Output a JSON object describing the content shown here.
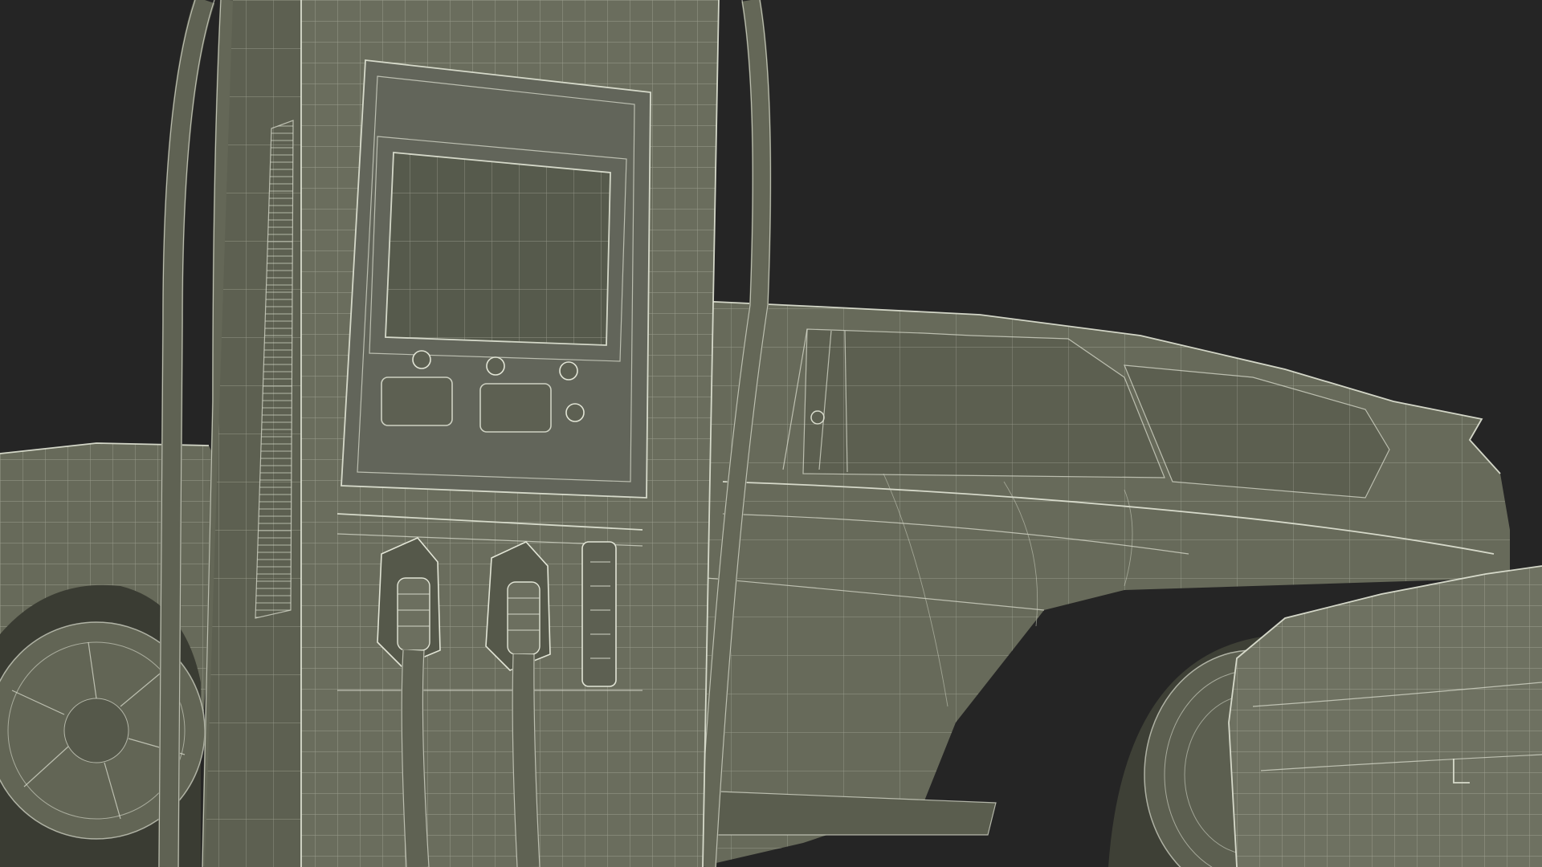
{
  "scene": {
    "subject": "wireframe-3d-render",
    "colors": {
      "background": "#252525",
      "mesh_fill": "#676a5a",
      "mesh_fill_dark": "#55584a",
      "mesh_fill_light": "#737665",
      "wire": "#d9dccd"
    },
    "objects": [
      {
        "name": "ev-charging-station",
        "connectors": 2,
        "buttons": 4,
        "panel_keys": 2
      },
      {
        "name": "suv-car"
      },
      {
        "name": "left-car"
      },
      {
        "name": "right-car-front"
      }
    ]
  }
}
